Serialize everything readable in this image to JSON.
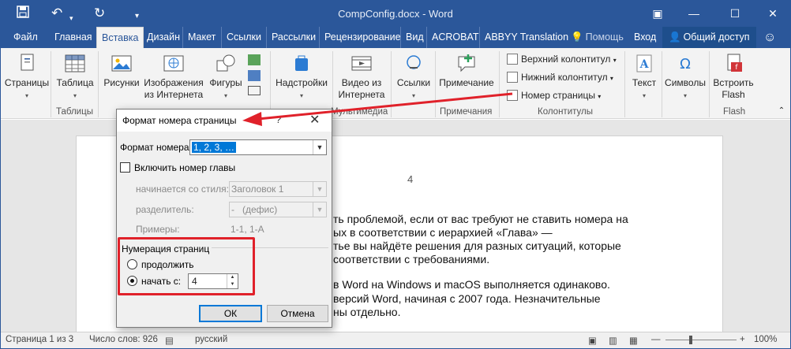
{
  "titlebar": {
    "title": "CompConfig.docx - Word",
    "save_icon": "save-icon",
    "undo_icon": "undo-icon",
    "redo_icon": "redo-icon",
    "qa_more": "customize-icon",
    "bg": "#2b579a"
  },
  "tabs": [
    {
      "label": "Файл"
    },
    {
      "label": "Главная"
    },
    {
      "label": "Вставка",
      "active": true
    },
    {
      "label": "Дизайн"
    },
    {
      "label": "Макет"
    },
    {
      "label": "Ссылки"
    },
    {
      "label": "Рассылки"
    },
    {
      "label": "Рецензирование"
    },
    {
      "label": "Вид"
    },
    {
      "label": "ACROBAT"
    },
    {
      "label": "ABBYY Translation"
    },
    {
      "label": "Помощь"
    },
    {
      "label": "Вход"
    },
    {
      "label": "Общий доступ"
    }
  ],
  "ribbon": {
    "pages": {
      "label": "Страницы"
    },
    "table": {
      "label": "Таблица",
      "group": "Таблицы"
    },
    "pictures": {
      "label": "Рисунки"
    },
    "online_pictures": {
      "label1": "Изображения",
      "label2": "из Интернета"
    },
    "shapes": {
      "label": "Фигуры"
    },
    "addins": {
      "label": "Надстройки"
    },
    "online_video": {
      "label1": "Видео из",
      "label2": "Интернета",
      "group": "Мультимедиа"
    },
    "links": {
      "label": "Ссылки"
    },
    "comment": {
      "label": "Примечание",
      "group": "Примечания"
    },
    "header": {
      "label": "Верхний колонтитул"
    },
    "footer": {
      "label": "Нижний колонтитул"
    },
    "page_number": {
      "label": "Номер страницы"
    },
    "hf_group": "Колонтитулы",
    "text": {
      "label": "Текст"
    },
    "symbols": {
      "label": "Символы"
    },
    "flash": {
      "label1": "Встроить",
      "label2": "Flash",
      "group": "Flash"
    }
  },
  "document": {
    "page_number": "4",
    "lines": [
      "ть проблемой, если от вас требуют не ставить номера на",
      "ых в соответствии с иерархией «Глава» —",
      "тье вы найдёте решения для разных ситуаций, которые",
      "соответствии с требованиями.",
      "в Word на Windows и macOS выполняется одинаково.",
      "версий Word, начиная с 2007 года. Незначительные",
      "ны отдельно."
    ]
  },
  "dialog": {
    "title": "Формат номера страницы",
    "help": "?",
    "close": "✕",
    "format_label": "Формат номера:",
    "format_value": "1, 2, 3, …",
    "include_chapter": "Включить номер главы",
    "starts_with_label": "начинается со стиля:",
    "starts_with_value": "Заголовок 1",
    "separator_label": "разделитель:",
    "separator_value": "-   (дефис)",
    "examples_label": "Примеры:",
    "examples_value": "1-1, 1-А",
    "numbering_label": "Нумерация страниц",
    "continue_label": "продолжить",
    "start_at_label": "начать с:",
    "start_at_value": "4",
    "ok": "ОК",
    "cancel": "Отмена"
  },
  "statusbar": {
    "page": "Страница 1 из 3",
    "words": "Число слов: 926",
    "language": "русский",
    "zoom": "100%"
  },
  "annotation_color": "#e0212a"
}
